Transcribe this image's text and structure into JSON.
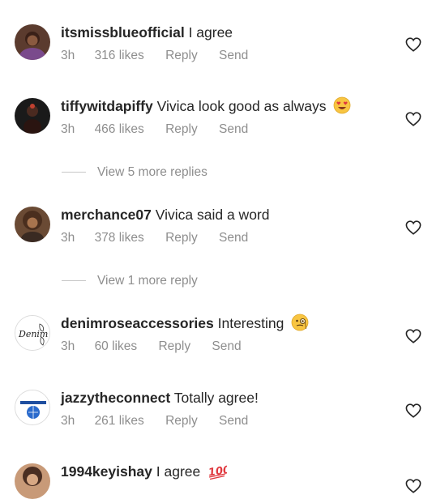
{
  "comments": [
    {
      "username": "itsmissblueofficial",
      "text": "I agree",
      "time": "3h",
      "likes": "316 likes",
      "reply": "Reply",
      "send": "Send",
      "avatar_icon": "user-avatar",
      "emoji_icon": ""
    },
    {
      "username": "tiffywitdapiffy",
      "text": "Vivica look good as always",
      "time": "3h",
      "likes": "466 likes",
      "reply": "Reply",
      "send": "Send",
      "avatar_icon": "user-avatar",
      "emoji_icon": "heart-eyes-emoji-icon"
    },
    {
      "username": "merchance07",
      "text": "Vivica said a word",
      "time": "3h",
      "likes": "378 likes",
      "reply": "Reply",
      "send": "Send",
      "avatar_icon": "user-avatar",
      "emoji_icon": ""
    },
    {
      "username": "denimroseaccessories",
      "text": "Interesting",
      "time": "3h",
      "likes": "60 likes",
      "reply": "Reply",
      "send": "Send",
      "avatar_icon": "brand-logo",
      "avatar_text": "Denim",
      "emoji_icon": "monocle-face-emoji-icon"
    },
    {
      "username": "jazzytheconnect",
      "text": "Totally agree!",
      "time": "3h",
      "likes": "261 likes",
      "reply": "Reply",
      "send": "Send",
      "avatar_icon": "brand-logo",
      "emoji_icon": ""
    },
    {
      "username": "1994keyishay",
      "text": "I agree",
      "time": "",
      "likes": "",
      "reply": "",
      "send": "",
      "avatar_icon": "user-avatar",
      "emoji_icon": "hundred-points-emoji-icon"
    }
  ],
  "view_replies": [
    {
      "label": "View 5 more replies"
    },
    {
      "label": "View 1 more reply"
    }
  ],
  "colors": {
    "text": "#262626",
    "muted": "#8e8e8e",
    "emoji_red": "#e0383e"
  }
}
